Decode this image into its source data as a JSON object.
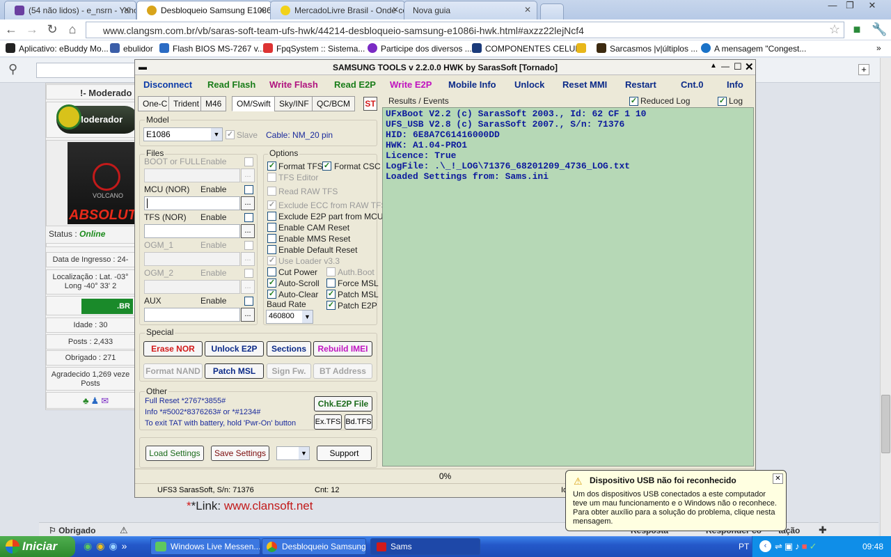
{
  "browser": {
    "tabs": [
      {
        "label": "(54 não lidos) - e_nsrn - Yaho",
        "icon": "mail-icon"
      },
      {
        "label": "Desbloqueio Samsung E1086i",
        "icon": "clangsm-icon"
      },
      {
        "label": "MercadoLivre Brasil - Onde co",
        "icon": "mercadolivre-icon"
      },
      {
        "label": "Nova guia",
        "icon": ""
      }
    ],
    "url": "www.clangsm.com.br/vb/saras-soft-team-ufs-hwk/44214-desbloqueio-samsung-e1086i-hwk.html#axzz22lejNcf4",
    "bookmarks": [
      "Aplicativo: eBuddy Mo...",
      "ebulidor",
      "Flash BIOS MS-7267 v...",
      "FpqSystem :: Sistema...",
      "Participe dos diversos ...",
      "COMPONENTES CELUL...",
      "Sarcasmos |v|últiplos ...",
      "A mensagem \"Congest..."
    ]
  },
  "forum": {
    "moderator_header": "!- Moderado",
    "moderator_badge": "Moderador",
    "avatar_text": "ABSOLUTE",
    "avatar_brand": "VOLCANO",
    "status_label": "Status :",
    "status_value": "Online",
    "info_rows": [
      "Data de Ingresso : 24-",
      "Localização : Lat. -03°",
      "Long -40° 33' 2",
      "Idade : 30",
      "Posts : 2,433",
      "Obrigado : 271",
      "Agradecido 1,269 veze",
      "Posts"
    ],
    "flag_text": ".BR",
    "link_prefix": "*Link:",
    "link_url": "www.clansoft.net",
    "obrigado": "Obrigado",
    "resposta": "Resposta",
    "responder": "Responder co",
    "citacao": "tação"
  },
  "st": {
    "title": "SAMSUNG TOOLS v 2.2.0.0 HWK by SarasSoft  [Tornado]",
    "menu": [
      {
        "label": "Disconnect",
        "color": "#0b3aa8"
      },
      {
        "label": "Read Flash",
        "color": "#1a7d1a"
      },
      {
        "label": "Write Flash",
        "color": "#b0147f"
      },
      {
        "label": "Read E2P",
        "color": "#1a7d1a"
      },
      {
        "label": "Write E2P",
        "color": "#c013c0"
      },
      {
        "label": "Mobile Info",
        "color": "#0b2a88"
      },
      {
        "label": "Unlock",
        "color": "#0b2a88"
      },
      {
        "label": "Reset MMI",
        "color": "#0b2a88"
      },
      {
        "label": "Restart",
        "color": "#0b2a88"
      },
      {
        "label": "Cnt.0",
        "color": "#0b2a88"
      },
      {
        "label": "Info",
        "color": "#0b2a88"
      }
    ],
    "tabs": [
      "One-C",
      "Trident",
      "M46",
      "OM/Swift",
      "Sky/INF",
      "QC/BCM"
    ],
    "st_btn": "ST",
    "model_label": "Model",
    "model_value": "E1086",
    "slave_label": "Slave",
    "cable_label": "Cable: NM_20 pin",
    "files_label": "Files",
    "enable": "Enable",
    "files": [
      "BOOT or FULL",
      "MCU (NOR)",
      "TFS (NOR)",
      "OGM_1",
      "OGM_2",
      "AUX"
    ],
    "options_label": "Options",
    "options": {
      "format_tfs": "Format TFS",
      "format_csc": "Format CSC",
      "tfs_editor": "TFS Editor",
      "read_raw_tfs": "Read RAW TFS",
      "exclude_ecc": "Exclude ECC from RAW TFS",
      "exclude_e2p": "Exclude E2P part from MCU",
      "cam_reset": "Enable CAM Reset",
      "mms_reset": "Enable MMS Reset",
      "default_reset": "Enable Default Reset",
      "use_loader": "Use Loader v3.3",
      "cut_power": "Cut Power",
      "auth_boot": "Auth.Boot",
      "auto_scroll": "Auto-Scroll",
      "force_msl": "Force MSL",
      "auto_clear": "Auto-Clear",
      "patch_msl": "Patch MSL",
      "baud_rate": "Baud Rate",
      "patch_e2p": "Patch E2P",
      "baud_value": "460800"
    },
    "special_label": "Special",
    "special": {
      "erase_nor": "Erase NOR",
      "unlock_e2p": "Unlock E2P",
      "sections": "Sections",
      "rebuild_imei": "Rebuild IMEI",
      "format_nand": "Format NAND",
      "patch_msl": "Patch MSL",
      "sign_fw": "Sign Fw.",
      "bt_address": "BT Address"
    },
    "other_label": "Other",
    "other_lines": [
      "Full Reset  *2767*3855#",
      "Info  *#5002*8376263#  or *#1234#",
      "To exit TAT with battery, hold 'Pwr-On' button"
    ],
    "chk_e2p": "Chk.E2P File",
    "ex_tfs": "Ex.TFS",
    "bd_tfs": "Bd.TFS",
    "load_settings": "Load Settings",
    "save_settings": "Save Settings",
    "support": "Support",
    "results_label": "Results / Events",
    "reduced_log": "Reduced Log",
    "log": "Log",
    "log_text": "UFxBoot V2.2 (c) SarasSoft 2003., Id: 62 CF 1 10\nUFS_USB V2.8 (c) SarasSoft 2007., S/n: 71376\nHID: 6E8A7C61416000DD\nHWK: A1.04-PRO1\nLicence: True\nLogFile: .\\_!_LOG\\71376_68201209_4736_LOG.txt\nLoaded Settings from: Sams.ini",
    "progress": "0%",
    "status_serial": "UFS3 SarasSoft, S/n: 71376",
    "status_cnt": "Cnt: 12",
    "status_extra": "Id"
  },
  "balloon": {
    "title": "Dispositivo USB não foi reconhecido",
    "body": "Um dos dispositivos USB conectados a este computador teve um mau funcionamento e o Windows não o reconhece.\nPara obter auxílio para a solução do problema, clique nesta mensagem."
  },
  "taskbar": {
    "start": "Iniciar",
    "tasks": [
      "Windows Live Messen...",
      "Desbloqueio Samsung...",
      "Sams"
    ],
    "lang": "PT",
    "clock": "09:48"
  }
}
